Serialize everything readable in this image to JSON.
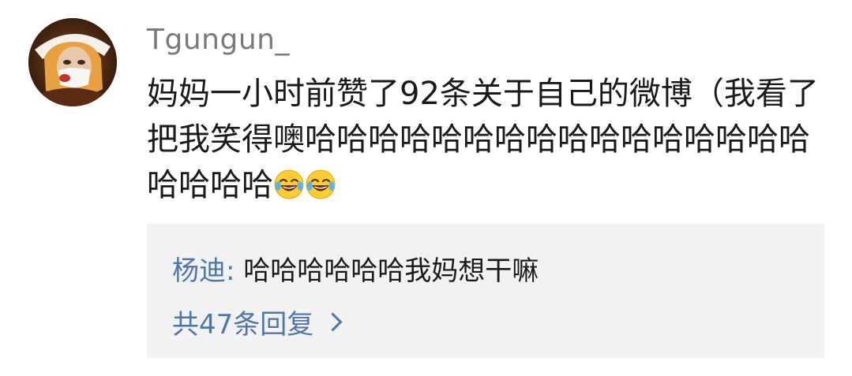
{
  "comment": {
    "username": "Tgungun_",
    "text": "妈妈一小时前赞了92条关于自己的微博（我看了把我笑得噢哈哈哈哈哈哈哈哈哈哈哈哈哈哈哈哈哈哈哈哈",
    "emojis": [
      "laugh-cry-emoji",
      "laugh-cry-emoji"
    ]
  },
  "reply": {
    "author": "杨迪",
    "colon": ":",
    "text": "哈哈哈哈哈哈我妈想干嘛",
    "count_label": "共47条回复"
  },
  "colors": {
    "link_blue": "#4e76a8",
    "username_gray": "#7a7a7a",
    "reply_bg": "#f2f2f2"
  }
}
